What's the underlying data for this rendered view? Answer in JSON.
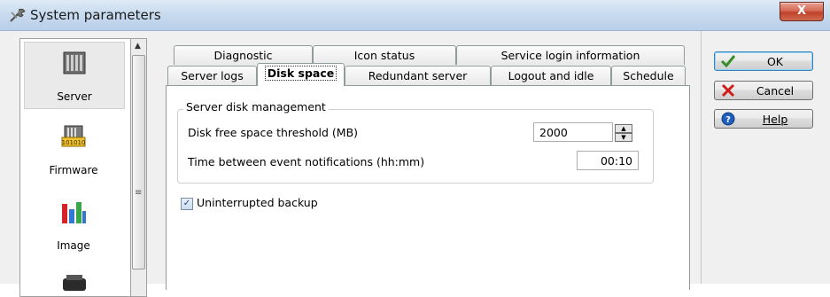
{
  "window": {
    "title": "System parameters",
    "close_glyph": "X",
    "title_icon": "wrench-icon"
  },
  "sidebar": {
    "items": [
      {
        "label": "Server",
        "icon": "server-icon",
        "selected": true
      },
      {
        "label": "Firmware",
        "icon": "firmware-icon",
        "selected": false
      },
      {
        "label": "Image",
        "icon": "image-chart-icon",
        "selected": false
      }
    ],
    "scroll_up": "▲",
    "scroll_grip": "≡"
  },
  "tabs": {
    "row_back": [
      {
        "label": "Diagnostic"
      },
      {
        "label": "Icon status"
      },
      {
        "label": "Service login information"
      }
    ],
    "row_front": [
      {
        "label": "Server logs"
      },
      {
        "label": "Disk space",
        "active": true
      },
      {
        "label": "Redundant server"
      },
      {
        "label": "Logout and idle"
      },
      {
        "label": "Schedule"
      }
    ]
  },
  "disk_space": {
    "group_title": "Server disk management",
    "threshold_label": "Disk free space threshold (MB)",
    "threshold_value": "2000",
    "interval_label": "Time between event notifications (hh:mm)",
    "interval_value": "00:10",
    "backup_label": "Uninterrupted backup",
    "backup_checked": true,
    "check_glyph": "✓"
  },
  "buttons": {
    "ok": {
      "label": "OK",
      "icon": "checkmark-icon"
    },
    "cancel": {
      "label": "Cancel",
      "icon": "x-icon"
    },
    "help": {
      "label": "Help",
      "icon": "help-icon"
    }
  },
  "colors": {
    "ok_green": "#3a8d2a",
    "cancel_red": "#d11a1a",
    "help_blue": "#1f5fbf"
  }
}
